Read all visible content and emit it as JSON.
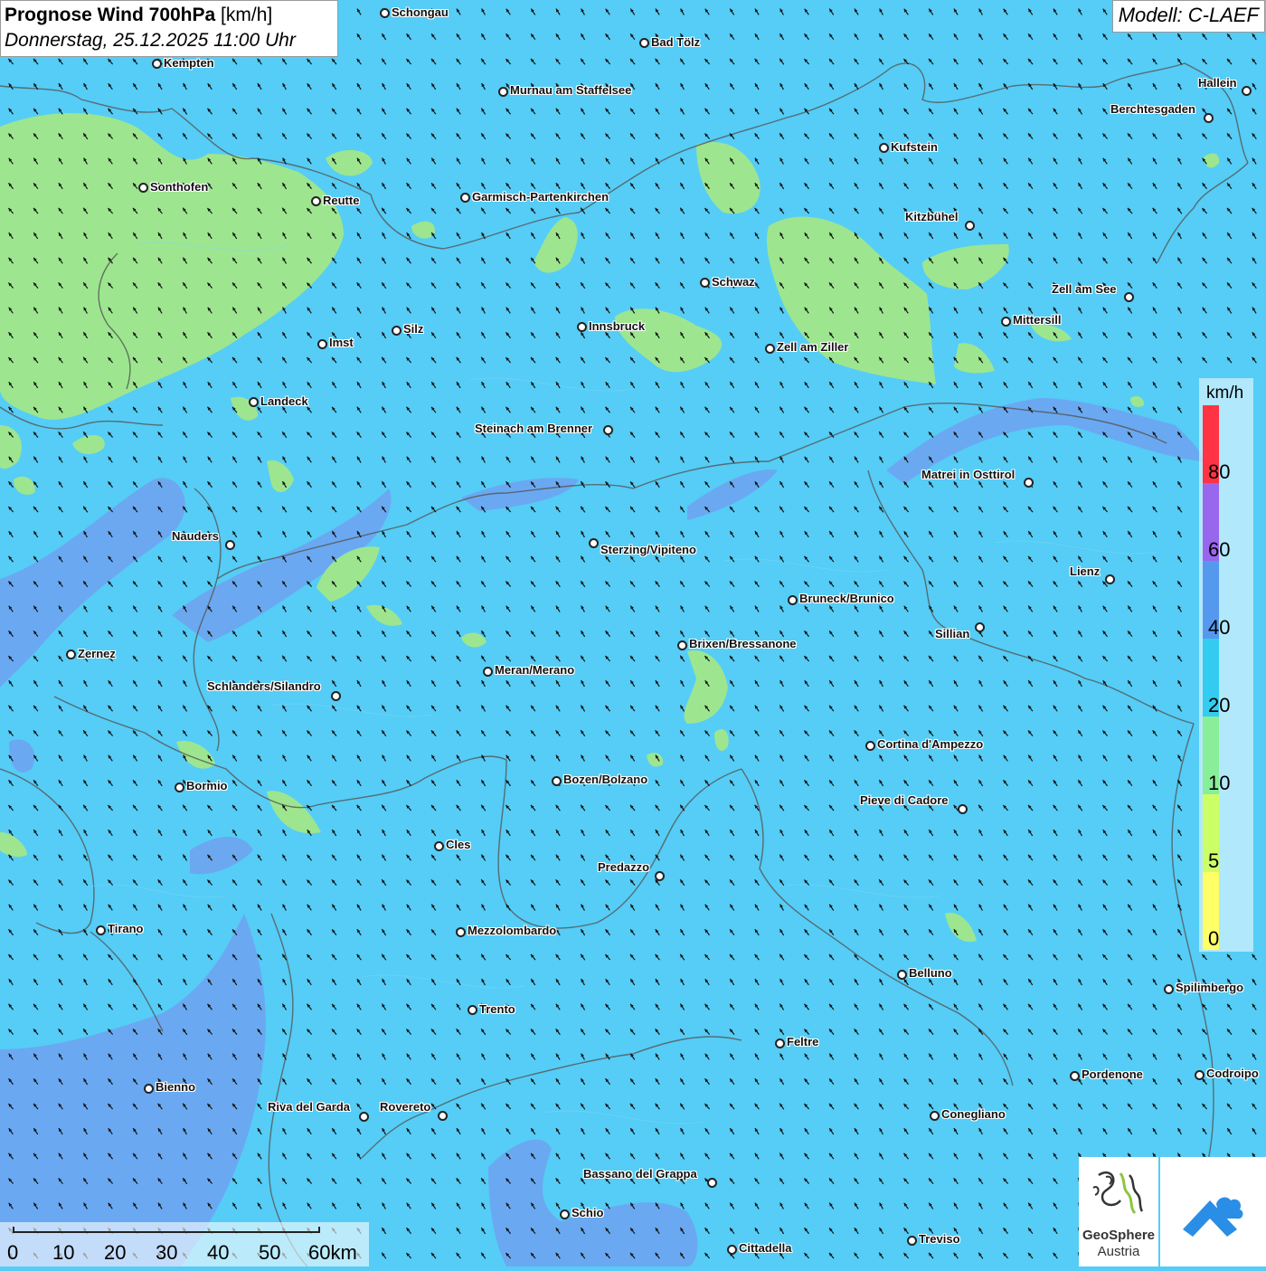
{
  "header": {
    "title_bold": "Prognose Wind 700hPa",
    "title_unit": " [km/h]",
    "date": "Donnerstag, 25.12.2025 11:00 Uhr",
    "model": "Modell: C-LAEF"
  },
  "cities": [
    "Schongau",
    "Bad Tölz",
    "Kempten",
    "Murnau am Staffelsee",
    "Hallein",
    "Berchtesgaden",
    "Kufstein",
    "Sonthofen",
    "Reutte",
    "Garmisch-Partenkirchen",
    "Kitzbühel",
    "Schwaz",
    "Zell am See",
    "Mittersill",
    "Silz",
    "Imst",
    "Innsbruck",
    "Zell am Ziller",
    "Landeck",
    "Steinach am Brenner",
    "Matrei in Osttirol",
    "Nauders",
    "Sterzing/Vipiteno",
    "Lienz",
    "Bruneck/Brunico",
    "Sillian",
    "Zernez",
    "Brixen/Bressanone",
    "Meran/Merano",
    "Schlanders/Silandro",
    "Cortina d'Ampezzo",
    "Bormio",
    "Bozen/Bolzano",
    "Pieve di Cadore",
    "Cles",
    "Predazzo",
    "Tirano",
    "Mezzolombardo",
    "Belluno",
    "Spilimbergo",
    "Trento",
    "Feltre",
    "Pordenone",
    "Codroipo",
    "Bienno",
    "Riva del Garda",
    "Rovereto",
    "Conegliano",
    "Bassano del Grappa",
    "Schio",
    "Treviso",
    "Cittadella"
  ],
  "legend": {
    "unit": "km/h",
    "ticks": [
      "0",
      "5",
      "10",
      "20",
      "40",
      "60",
      "80"
    ],
    "colors": [
      "#ffff66",
      "#ccff66",
      "#88ee99",
      "#33ccf0",
      "#5599ee",
      "#9966ee",
      "#ff3344"
    ]
  },
  "scale": {
    "labels": [
      "0",
      "10",
      "20",
      "30",
      "40",
      "50",
      "60km"
    ]
  },
  "logo": {
    "name": "GeoSphere",
    "country": "Austria"
  },
  "colors": {
    "background": "#55cdf6",
    "calm_zone": "#99e890",
    "light_zone": "#b5ec80",
    "windy_zone": "#7494f0"
  }
}
